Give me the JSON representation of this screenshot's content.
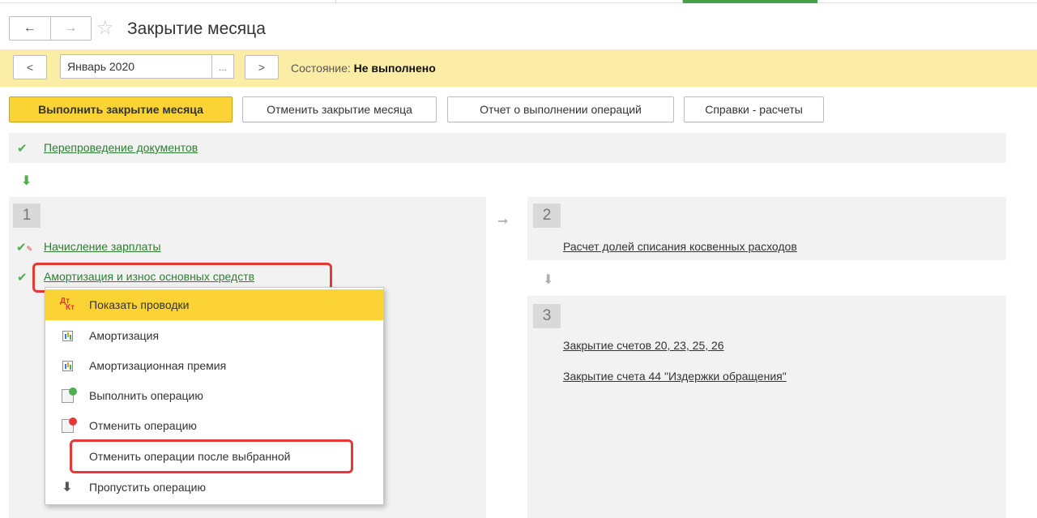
{
  "window": {
    "title": "Закрытие месяца",
    "nav_back": "←",
    "nav_forward": "→",
    "favorite": "☆"
  },
  "period": {
    "prev": "<",
    "value": "Январь 2020",
    "select": "...",
    "next": ">",
    "state_label": "Состояние:",
    "state_value": "Не выполнено"
  },
  "actions": {
    "run": "Выполнить закрытие месяца",
    "cancel": "Отменить закрытие месяца",
    "report": "Отчет о выполнении операций",
    "help": "Справки - расчеты"
  },
  "steps": {
    "repost": "Перепроведение документов",
    "step1": {
      "number": "1",
      "items": [
        "Начисление зарплаты",
        "Амортизация и износ основных средств"
      ]
    },
    "step2": {
      "number": "2",
      "items": [
        "Расчет долей списания косвенных расходов"
      ]
    },
    "step3": {
      "number": "3",
      "items": [
        "Закрытие счетов 20, 23, 25, 26",
        "Закрытие счета 44 \"Издержки обращения\""
      ]
    }
  },
  "context_menu": {
    "items": [
      {
        "label": "Показать проводки",
        "icon": "dt-kt-icon"
      },
      {
        "label": "Амортизация",
        "icon": "report-icon"
      },
      {
        "label": "Амортизационная премия",
        "icon": "report-icon"
      },
      {
        "label": "Выполнить операцию",
        "icon": "run-operation-icon"
      },
      {
        "label": "Отменить операцию",
        "icon": "cancel-operation-icon"
      },
      {
        "label": "Отменить операции после выбранной",
        "icon": ""
      },
      {
        "label": "Пропустить операцию",
        "icon": "skip-arrow-icon"
      }
    ],
    "dt": "Дт",
    "kt": "Кт"
  },
  "colors": {
    "accent_yellow": "#fbd335",
    "bar_yellow": "#fbeda5",
    "link_green": "#2e7d32",
    "highlight_red": "#e53935"
  }
}
